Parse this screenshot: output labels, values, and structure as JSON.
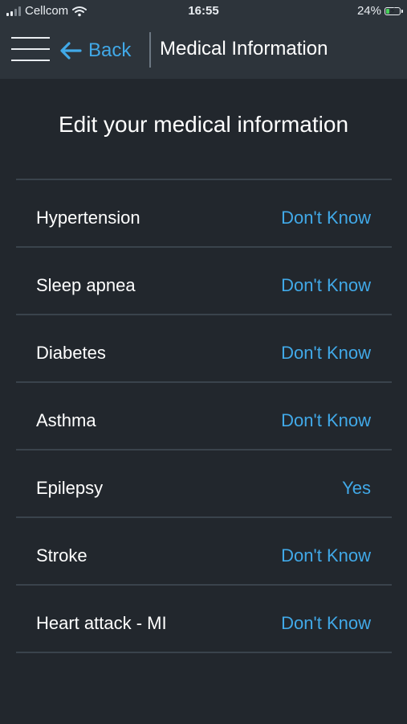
{
  "status": {
    "carrier": "Cellcom",
    "time": "16:55",
    "battery_percent": "24%",
    "battery_level": 0.24,
    "battery_color": "#47d15a",
    "icons": {
      "signal": "signal-icon",
      "wifi": "wifi-icon",
      "battery": "battery-icon"
    }
  },
  "nav": {
    "menu_icon": "hamburger-menu-icon",
    "back_icon": "arrow-left-icon",
    "back_label": "Back",
    "title": "Medical Information"
  },
  "heading": "Edit your medical information",
  "conditions": [
    {
      "label": "Hypertension",
      "value": "Don't Know"
    },
    {
      "label": "Sleep apnea",
      "value": "Don't Know"
    },
    {
      "label": "Diabetes",
      "value": "Don't Know"
    },
    {
      "label": "Asthma",
      "value": "Don't Know"
    },
    {
      "label": "Epilepsy",
      "value": "Yes"
    },
    {
      "label": "Stroke",
      "value": "Don't Know"
    },
    {
      "label": "Heart attack - MI",
      "value": "Don't Know"
    }
  ],
  "colors": {
    "background": "#22272d",
    "header": "#2d343b",
    "accent": "#41a9e8",
    "divider": "#3a434c"
  }
}
